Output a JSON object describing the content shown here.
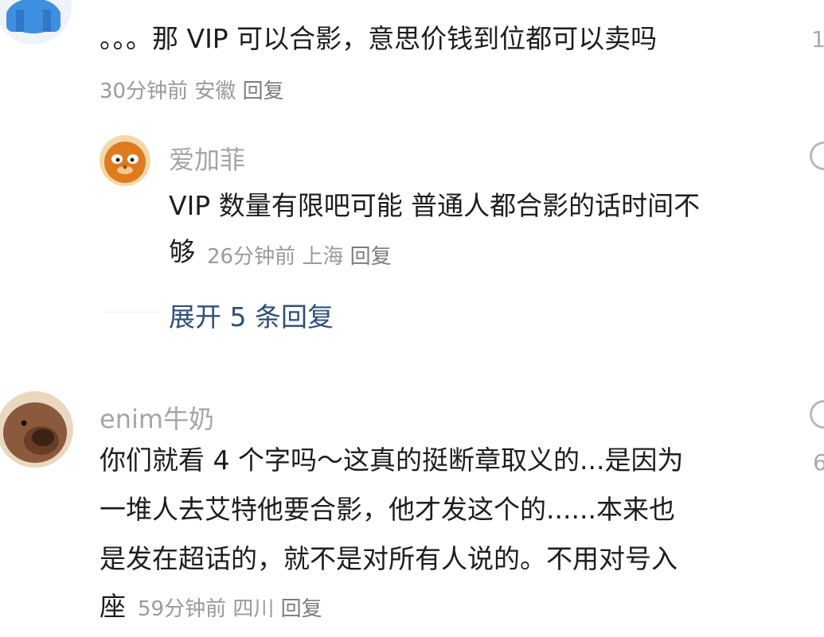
{
  "comments": [
    {
      "text_lines": [
        "。。。那 VIP 可以合影，意思价钱到位都可以卖吗"
      ],
      "time": "30分钟前",
      "location": "安徽",
      "reply_label": "回复",
      "right_fragment": "1",
      "replies": [
        {
          "username": "爱加菲",
          "text_lines": [
            "VIP 数量有限吧可能 普通人都合影的话时间不",
            "够"
          ],
          "time": "26分钟前",
          "location": "上海",
          "reply_label": "回复"
        }
      ],
      "expand_label": "展开 5 条回复"
    },
    {
      "username": "enim牛奶",
      "text_lines": [
        "你们就看 4 个字吗～这真的挺断章取义的...是因为",
        "一堆人去艾特他要合影，他才发这个的......本来也",
        "是发在超话的，就不是对所有人说的。不用对号入",
        "座"
      ],
      "time": "59分钟前",
      "location": "四川",
      "reply_label": "回复",
      "right_fragment": "6"
    }
  ],
  "colors": {
    "meta_gray": "#9a9a9a",
    "username_gray": "#a5a5a5",
    "expand_blue": "#2e4f7c",
    "avatar1_blue": "#3f8fe0"
  },
  "icons": [
    "user-avatar-icon",
    "garfield-avatar",
    "otter-avatar",
    "comment-bubble-icon"
  ]
}
